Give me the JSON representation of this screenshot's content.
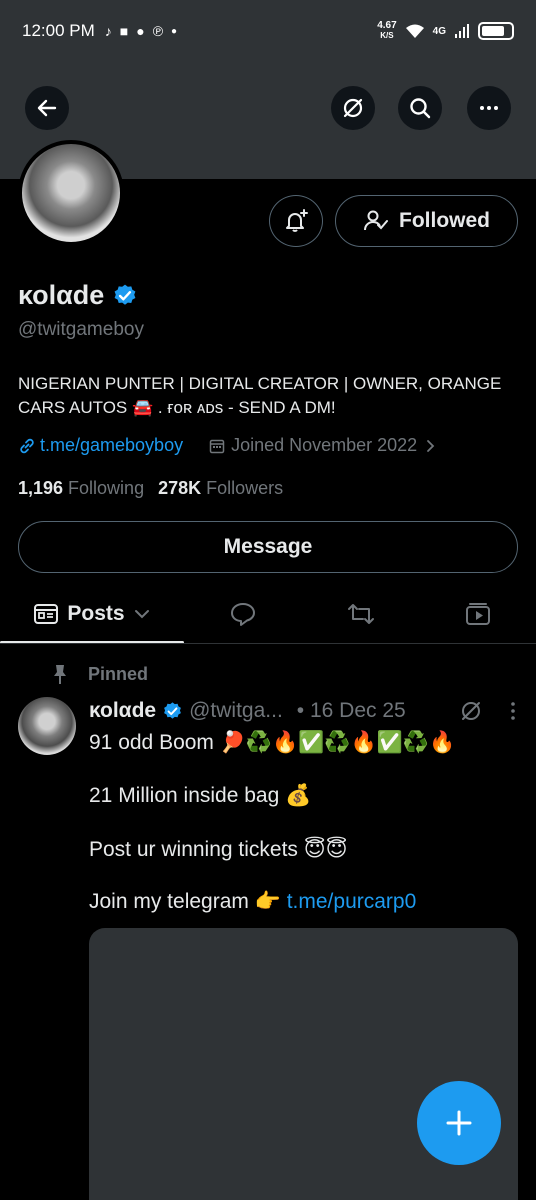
{
  "status": {
    "time": "12:00 PM",
    "net_speed": "4.67",
    "net_unit": "K/S",
    "network": "4G"
  },
  "profile": {
    "display_name": "κοlαde",
    "handle": "@twitgameboy",
    "bio": "NIGERIAN PUNTER | DIGITAL CREATOR | OWNER, ORANGE CARS AUTOS 🚘 . ғᴏʀ ᴀᴅs - SEND A DM!",
    "link": "t.me/gameboyboy",
    "joined": "Joined November 2022",
    "following_count": "1,196",
    "following_label": "Following",
    "followers_count": "278K",
    "followers_label": "Followers",
    "followed_label": "Followed",
    "message_label": "Message"
  },
  "tabs": {
    "posts_label": "Posts"
  },
  "post": {
    "pinned_label": "Pinned",
    "name": "κοlαde",
    "handle": "@twitga...",
    "date": "• 16 Dec 25",
    "line1": "91 odd Boom 🏓♻️🔥✅♻️🔥✅♻️🔥",
    "line2": "21 Million inside bag 💰",
    "line3": "Post ur winning tickets 😇😇",
    "line4_prefix": "Join my telegram 👉 ",
    "line4_link": "t.me/purcarp0"
  },
  "colors": {
    "accent": "#1d9bf0",
    "banner": "#2f3336",
    "muted": "#71767b"
  },
  "icons": [
    "back-arrow-icon",
    "grok-icon",
    "search-icon",
    "more-icon",
    "bell-plus-icon",
    "person-check-icon",
    "verified-badge-icon",
    "link-icon",
    "calendar-icon",
    "chevron-right-icon",
    "posts-icon",
    "chevron-down-icon",
    "reply-icon",
    "retweet-icon",
    "media-icon",
    "pin-icon",
    "compose-plus-icon"
  ]
}
